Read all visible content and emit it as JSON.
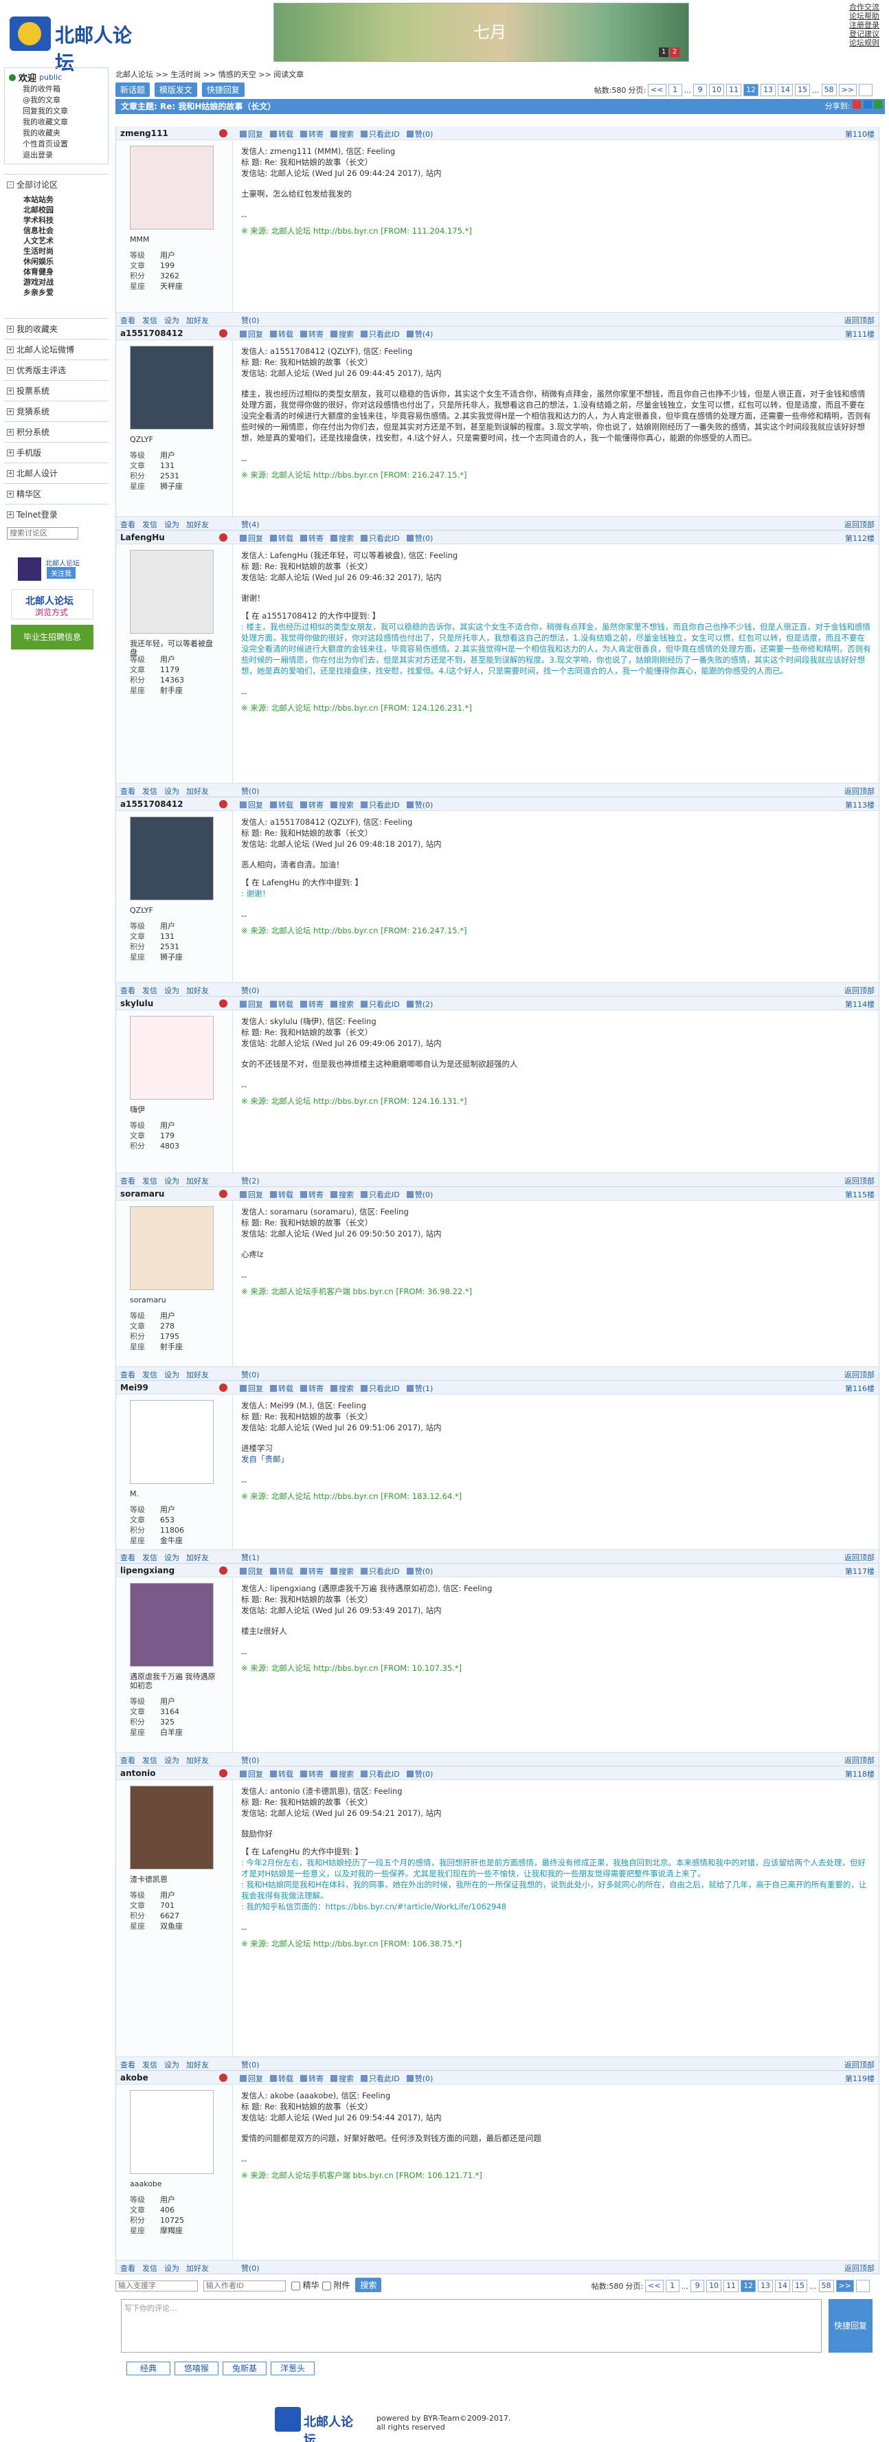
{
  "header": {
    "logo_text": "北邮人论坛",
    "banner_text": "七月",
    "banner_dots": [
      "1",
      "2"
    ],
    "top_links": [
      "合作交流",
      "论坛帮助",
      "注册登录",
      "登记建议",
      "论坛规则"
    ]
  },
  "sidebar": {
    "welcome": "欢迎",
    "welcome_user": "public",
    "user_links": [
      "我的收件箱",
      "@我的文章",
      "回复我的文章",
      "我的收藏文章",
      "我的收藏夹",
      "个性首页设置",
      "退出登录"
    ],
    "all_sections": "全部讨论区",
    "sections": [
      "本站站务",
      "北邮校园",
      "学术科技",
      "信息社会",
      "人文艺术",
      "生活时尚",
      "休闲娱乐",
      "体育健身",
      "游戏对战",
      "乡亲乡爱"
    ],
    "other": [
      "我的收藏夹",
      "北邮人论坛微博",
      "优秀版主评选",
      "投票系统",
      "竞猜系统",
      "积分系统",
      "手机版",
      "北邮人设计",
      "精华区",
      "Telnet登录"
    ],
    "search_placeholder": "搜索讨论区",
    "weibo": "北邮人论坛",
    "weibo_btn": "关注我",
    "ad1": "北邮人论坛",
    "ad1_sub": "浏览方式",
    "ad2": "毕业生招聘信息"
  },
  "main": {
    "breadcrumb": "北邮人论坛 >> 生活时尚 >> 情感的天空 >> 阅读文章",
    "buttons": [
      "新话题",
      "模版发文",
      "快捷回复"
    ],
    "post_count": "帖数:580",
    "page_label": "分页:",
    "pages": [
      "<<",
      "1",
      "...",
      "9",
      "10",
      "11",
      "12",
      "13",
      "14",
      "15",
      "...",
      "58",
      ">>"
    ],
    "current_page": "12",
    "topic_title": "文章主题: Re: 我和H姑娘的故事（长文）",
    "share": "分享到:"
  },
  "actions": [
    "回复",
    "转载",
    "转寄",
    "搜索",
    "只看此ID",
    "删(0)"
  ],
  "foot_actions": [
    "查看",
    "发信",
    "设为",
    "加好友"
  ],
  "foot_like": "赞(0)",
  "back_top": "返回顶部",
  "posts": [
    {
      "user": "zmeng111",
      "floor": "第110楼",
      "nick": "MMM",
      "level": "用户",
      "articles": "199",
      "points": "3262",
      "star": "天秤座",
      "h1": "发信人: zmeng111 (MMM), 信区: Feeling",
      "h2": "标  题: Re: 我和H姑娘的故事（长文）",
      "h3": "发信站: 北邮人论坛 (Wed Jul 26 09:44:24 2017), 站内",
      "body": "土豪啊，怎么给红包发给我发的",
      "sig": "※ 来源: 北邮人论坛 http://bbs.byr.cn [FROM: 111.204.175.*]",
      "like": "赞(0)"
    },
    {
      "user": "a1551708412",
      "floor": "第111楼",
      "nick": "QZLYF",
      "level": "用户",
      "articles": "131",
      "points": "2531",
      "star": "狮子座",
      "h1": "发信人: a1551708412 (QZLYF), 信区: Feeling",
      "h2": "标  题: Re: 我和H姑娘的故事（长文）",
      "h3": "发信站: 北邮人论坛 (Wed Jul 26 09:44:45 2017), 站内",
      "body": "楼主，我也经历过相似的类型女朋友，我可以稳稳的告诉你，其实这个女生不适合你，稍微有点拜金，虽然你家里不想钱，而且你自己也挣不少钱，但是人很正直，对于金钱和感情处理方面，我觉得你做的很好，你对这段感情也付出了，只是所托非人，我想看这自己的想法，1.没有结婚之前，尽量金钱独立，女生可以惯，红包可以转，但是适度，而且不要在没完全看清的时候进行大额度的金钱来往，毕竟容易伤感情。2.其实我觉得H是一个相信我和达力的人，为人肯定很善良，但毕竟在感情的处理方面，还需要一些帝修和精明，否则有些时候的一厢情愿，你在付出为你们去，但是其实对方还是不到，甚至能到误解的程度。3.现文学响，你也说了，姑娘刚刚经历了一番失败的感情，其实这个时间段我就应该好好想想，她是真的爱咱们，还是找接盘侠，找安慰，4.l这个好人，只是需要时间，找一个志同道合的人，我一个能懂得你真心，能跟的你感受的人而已。",
      "sig": "※ 来源: 北邮人论坛 http://bbs.byr.cn [FROM: 216.247.15.*]",
      "like": "赞(4)"
    },
    {
      "user": "LafengHu",
      "floor": "第112楼",
      "nick": "我还年轻，可以等着被盘盘",
      "level": "用户",
      "articles": "1179",
      "points": "14363",
      "star": "射手座",
      "h1": "发信人: LafengHu (我还年轻，可以等着被盘), 信区: Feeling",
      "h2": "标  题: Re: 我和H姑娘的故事（长文）",
      "h3": "发信站: 北邮人论坛 (Wed Jul 26 09:46:32 2017), 站内",
      "body": "谢谢！",
      "quote_head": "【 在 a1551708412 的大作中提到: 】",
      "quote": ": 楼主，我也经历过相似的类型女朋友，我可以稳稳的告诉你，其实这个女生不适合你，稍微有点拜金，虽然你家里不想钱，而且你自己也挣不少钱，但是人很正直，对于金钱和感情处理方面，我觉得你做的很好，你对这段感情也付出了，只是所托非人，我想看这自己的想法，1.没有结婚之前，尽量金钱独立，女生可以惯，红包可以转，但是适度，而且不要在没完全看清的时候进行大额度的金钱来往，毕竟容易伤感情。2.其实我觉得H是一个相信我和达力的人，为人肯定很善良，但毕竟在感情的处理方面，还需要一些帝修和精明，否则有些时候的一厢情愿，你在付出为你们去，但是其实对方还是不到，甚至能到误解的程度。3.现文学响，你也说了，姑娘刚刚经历了一番失败的感情，其实这个时间段我就应该好好想想，她是真的爱咱们，还是找接盘侠，找安慰，找爱恒。4.l这个好人，只是需要时间，找一个志同道合的人，我一个能懂得你真心，能跟的你感受的人而已。",
      "sig": "※ 来源: 北邮人论坛 http://bbs.byr.cn [FROM: 124.126.231.*]",
      "like": "赞(0)"
    },
    {
      "user": "a1551708412",
      "floor": "第113楼",
      "nick": "QZLYF",
      "level": "用户",
      "articles": "131",
      "points": "2531",
      "star": "狮子座",
      "h1": "发信人: a1551708412 (QZLYF), 信区: Feeling",
      "h2": "标  题: Re: 我和H姑娘的故事（长文）",
      "h3": "发信站: 北邮人论坛 (Wed Jul 26 09:48:18 2017), 站内",
      "body": "恶人相向，清者自清。加油！",
      "quote_head": "【 在 LafengHu 的大作中提到: 】",
      "quote": ": 谢谢！",
      "sig": "※ 来源: 北邮人论坛 http://bbs.byr.cn [FROM: 216.247.15.*]",
      "like": "赞(0)"
    },
    {
      "user": "skylulu",
      "floor": "第114楼",
      "nick": "嗨伊",
      "level": "用户",
      "articles": "179",
      "points": "4803",
      "star": "",
      "h1": "发信人: skylulu (嗨伊), 信区: Feeling",
      "h2": "标  题: Re: 我和H姑娘的故事（长文）",
      "h3": "发信站: 北邮人论坛 (Wed Jul 26 09:49:06 2017), 站内",
      "body": "女的不还钱是不对，但是我也神烦楼主这种磨磨唧唧自认为是还挺制欲超强的人",
      "sig": "※ 来源: 北邮人论坛 http://bbs.byr.cn [FROM: 124.16.131.*]",
      "like": "赞(2)"
    },
    {
      "user": "soramaru",
      "floor": "第115楼",
      "nick": "soramaru",
      "level": "用户",
      "articles": "278",
      "points": "1795",
      "star": "射手座",
      "h1": "发信人: soramaru (soramaru), 信区: Feeling",
      "h2": "标  题: Re: 我和H姑娘的故事（长文）",
      "h3": "发信站: 北邮人论坛 (Wed Jul 26 09:50:50 2017), 站内",
      "body": "心疼lz",
      "sig": "※ 来源: 北邮人论坛手机客户端 bbs.byr.cn [FROM: 36.98.22.*]",
      "like": "赞(0)"
    },
    {
      "user": "Mei99",
      "floor": "第116楼",
      "nick": "M.",
      "level": "用户",
      "articles": "653",
      "points": "11806",
      "star": "金牛座",
      "h1": "发信人: Mei99 (M.), 信区: Feeling",
      "h2": "标  题: Re: 我和H姑娘的故事（长文）",
      "h3": "发信站: 北邮人论坛 (Wed Jul 26 09:51:06 2017), 站内",
      "body": "进楼学习",
      "extra": "发自「贵邮」",
      "sig": "※ 来源: 北邮人论坛 http://bbs.byr.cn [FROM: 183.12.64.*]",
      "like": "赞(1)"
    },
    {
      "user": "lipengxiang",
      "floor": "第117楼",
      "nick": "遇原虐我千万遍 我待遇原如初恋",
      "level": "用户",
      "articles": "3164",
      "points": "325",
      "star": "白羊座",
      "h1": "发信人: lipengxiang (遇原虐我千万遍 我待遇原如初恋), 信区: Feeling",
      "h2": "标  题: Re: 我和H姑娘的故事（长文）",
      "h3": "发信站: 北邮人论坛 (Wed Jul 26 09:53:49 2017), 站内",
      "body": "楼主lz很好人",
      "sig": "※ 来源: 北邮人论坛 http://bbs.byr.cn [FROM: 10.107.35.*]",
      "like": "赞(0)"
    },
    {
      "user": "antonio",
      "floor": "第118楼",
      "nick": "渣卡德凯恩",
      "level": "用户",
      "articles": "701",
      "points": "6627",
      "star": "双鱼座",
      "h1": "发信人: antonio (渣卡德凯恩), 信区: Feeling",
      "h2": "标  题: Re: 我和H姑娘的故事（长文）",
      "h3": "发信站: 北邮人论坛 (Wed Jul 26 09:54:21 2017), 站内",
      "body": "鼓励你好",
      "quote_head": "【 在 LafengHu 的大作中提到: 】",
      "quote": ": 今年2月份左右，我和H姑娘经历了一段五个月的感情，我回想肝肝也是前方面感情，最终没有修成正果，我独自回到北京。本来感情和我中的对错，应该留给两个人去处理，但好才是对H姑娘是一些意义，以及对我的一些保养。尤其是我们现在的一些不愉快，让我和我的一些朋友觉得需要把整件事说清上来了。\n: 我和H姑娘同是我和H在体科，我的同事，她在外出的时候，我所在的一所保证我想的，说到此处小，好多就同心的所在，自由之后，就给了几年，高于自己离开的所有重要的，让我会我得有我做法理解。\n: 我的知乎私信页面的：https://bbs.byr.cn/#!article/WorkLife/1062948",
      "sig": "※ 来源: 北邮人论坛 http://bbs.byr.cn [FROM: 106.38.75.*]",
      "like": "赞(0)"
    },
    {
      "user": "akobe",
      "floor": "第119楼",
      "nick": "aaakobe",
      "level": "用户",
      "articles": "406",
      "points": "10725",
      "star": "摩羯座",
      "h1": "发信人: akobe (aaakobe), 信区: Feeling",
      "h2": "标  题: Re: 我和H姑娘的故事（长文）",
      "h3": "发信站: 北邮人论坛 (Wed Jul 26 09:54:44 2017), 站内",
      "body": "爱情的问题都是双方的问题，好聚好散吧。任何涉及到钱方面的问题，最后都还是问题",
      "sig": "※ 来源: 北邮人论坛手机客户端 bbs.byr.cn [FROM: 106.121.71.*]",
      "like": "赞(0)"
    }
  ],
  "bottom": {
    "user_ph": "输入支援字",
    "quick_ph": "输入作者ID",
    "check1": "精华",
    "check2": "附件",
    "search_btn": "搜索",
    "reply_ph": "写下你的评论…",
    "quick_reply": "快捷回复",
    "emos": [
      "经典",
      "悠嘻猴",
      "兔斯基",
      "洋葱头"
    ]
  },
  "footer": {
    "logo": "北邮人论坛",
    "l1": "powered by BYR-Team©2009-2017.",
    "l2": "all rights reserved"
  },
  "labels": {
    "level": "等级",
    "articles": "文章",
    "points": "积分",
    "star": "星座"
  }
}
